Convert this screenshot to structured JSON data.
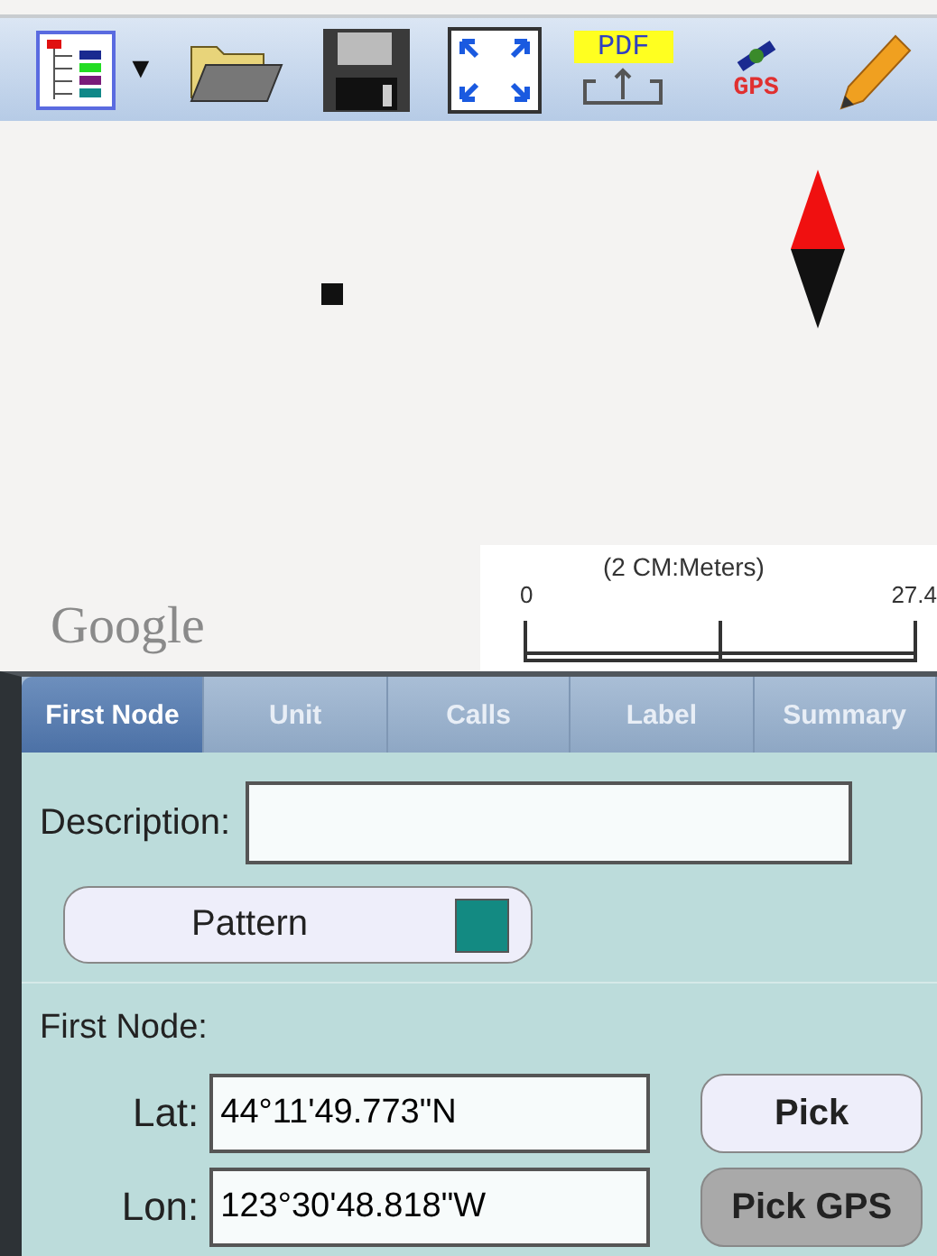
{
  "toolbar": {
    "caret": "▼",
    "pdf_label": "PDF",
    "gps_label": "GPS"
  },
  "map": {
    "logo": "Google",
    "scale": {
      "title": "(2 CM:Meters)",
      "start": "0",
      "end": "27.4"
    }
  },
  "tabs": [
    {
      "label": "First Node",
      "selected": true
    },
    {
      "label": "Unit",
      "selected": false
    },
    {
      "label": "Calls",
      "selected": false
    },
    {
      "label": "Label",
      "selected": false
    },
    {
      "label": "Summary",
      "selected": false
    }
  ],
  "description": {
    "label": "Description:"
  },
  "pattern": {
    "label": "Pattern",
    "color": "#138a82"
  },
  "first_node": {
    "heading": "First Node:",
    "rows": [
      {
        "label": "Lat:",
        "value": "44°11'49.773\"N",
        "button": "Pick",
        "disabled": false
      },
      {
        "label": "Lon:",
        "value": "123°30'48.818\"W",
        "button": "Pick GPS",
        "disabled": true
      }
    ]
  }
}
